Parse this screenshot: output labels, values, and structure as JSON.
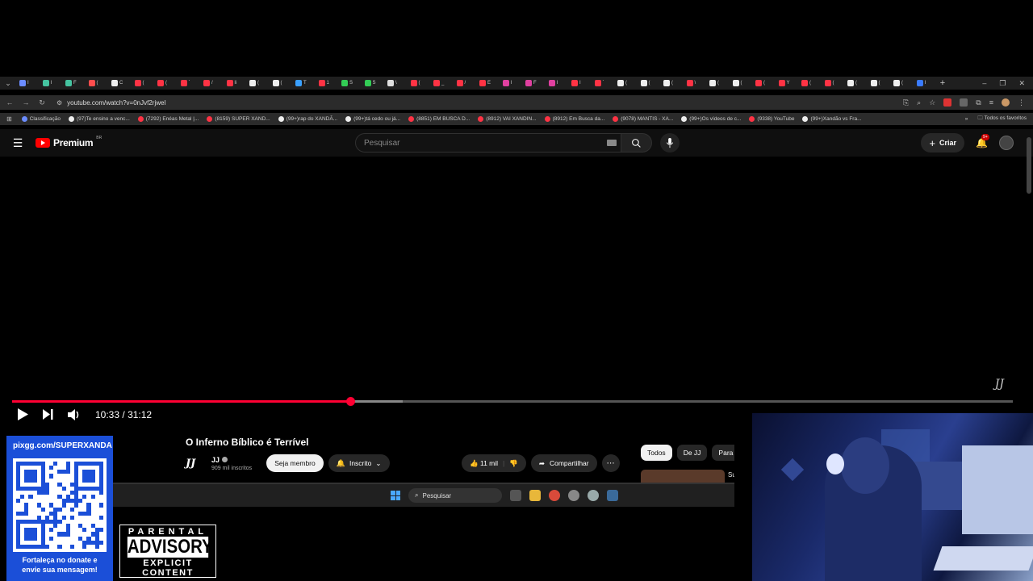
{
  "browser": {
    "tabs": [
      {
        "text": "I",
        "color": "#6b8cff"
      },
      {
        "text": "I",
        "color": "#45c3a0"
      },
      {
        "text": "F",
        "color": "#45c3a0"
      },
      {
        "text": "(",
        "color": "#ff4d4d"
      },
      {
        "text": "C",
        "color": "#eeeeee"
      },
      {
        "text": "(",
        "color": "#ff3344"
      },
      {
        "text": "(",
        "color": "#ff3344"
      },
      {
        "text": "`",
        "color": "#ff3344"
      },
      {
        "text": "/",
        "color": "#ff3344"
      },
      {
        "text": "li",
        "color": "#ff3344"
      },
      {
        "text": "(",
        "color": "#eeeeee"
      },
      {
        "text": "(",
        "color": "#eeeeee"
      },
      {
        "text": "T",
        "color": "#3aa0ff"
      },
      {
        "text": "1",
        "color": "#ff3344"
      },
      {
        "text": "S",
        "color": "#33cc55"
      },
      {
        "text": "S",
        "color": "#33cc55"
      },
      {
        "text": "\\",
        "color": "#dddddd"
      },
      {
        "text": "(",
        "color": "#ff3344"
      },
      {
        "text": "_",
        "color": "#ff3344"
      },
      {
        "text": "/",
        "color": "#ff3344"
      },
      {
        "text": "E",
        "color": "#ff3344"
      },
      {
        "text": "I",
        "color": "#e040a0"
      },
      {
        "text": "F",
        "color": "#e040a0"
      },
      {
        "text": "I",
        "color": "#e040a0"
      },
      {
        "text": "I",
        "color": "#ff3344"
      },
      {
        "text": "`",
        "color": "#ff3344"
      },
      {
        "text": "(",
        "color": "#eeeeee"
      },
      {
        "text": "(",
        "color": "#eeeeee"
      },
      {
        "text": "(",
        "color": "#eeeeee"
      },
      {
        "text": "\\",
        "color": "#ff3344"
      },
      {
        "text": "(",
        "color": "#eeeeee"
      },
      {
        "text": "(",
        "color": "#eeeeee"
      },
      {
        "text": "(",
        "color": "#ff3344"
      },
      {
        "text": "Y",
        "color": "#ff3344"
      },
      {
        "text": "(",
        "color": "#ff3344"
      },
      {
        "text": "(",
        "color": "#ff3344"
      },
      {
        "text": "(",
        "color": "#eeeeee"
      },
      {
        "text": "(",
        "color": "#eeeeee"
      },
      {
        "text": "(",
        "color": "#eeeeee"
      },
      {
        "text": "I",
        "color": "#3a7bff"
      }
    ],
    "new_tab": "+",
    "window_controls": [
      "–",
      "❐",
      "✕"
    ],
    "url": "youtube.com/watch?v=0nJvf2rjweI",
    "bookmarks": [
      {
        "label": "Classificação",
        "color": "#6b8cff"
      },
      {
        "label": "(97)Te ensino a venc...",
        "color": "#eeeeee"
      },
      {
        "label": "(7292) Enéas Metal |...",
        "color": "#ff3344"
      },
      {
        "label": "(8159) SUPER XAND...",
        "color": "#ff3344"
      },
      {
        "label": "(99+)rap do XANDÃ...",
        "color": "#eeeeee"
      },
      {
        "label": "(99+)tá cedo ou já...",
        "color": "#eeeeee"
      },
      {
        "label": "(8851) EM BUSCA D...",
        "color": "#ff3344"
      },
      {
        "label": "(8912) VAI XANDIN...",
        "color": "#ff3344"
      },
      {
        "label": "(8912) Em Busca da...",
        "color": "#ff3344"
      },
      {
        "label": "(9078) MANTIS - XA...",
        "color": "#ff3344"
      },
      {
        "label": "(99+)Os vídeos de c...",
        "color": "#eeeeee"
      },
      {
        "label": "(9338) YouTube",
        "color": "#ff3344"
      },
      {
        "label": "(99+)Xandão vs Fra...",
        "color": "#eeeeee"
      }
    ],
    "bookmarks_more": "»",
    "all_favorites": "Todos os favoritos"
  },
  "yt": {
    "logo_text": "Premium",
    "region": "BR",
    "search_placeholder": "Pesquisar",
    "create_label": "Criar",
    "notif_count": "9+"
  },
  "player": {
    "current_time": "10:33",
    "duration": "31:12",
    "time_sep": "/",
    "progress_played": 0.338,
    "progress_buffered": 0.39,
    "watermark": "JJ"
  },
  "video": {
    "title": "O Inferno Bíblico é Terrível",
    "channel_logo": "JJ",
    "channel_name": "JJ",
    "subscribers": "909 mil inscritos",
    "join_label": "Seja membro",
    "subscribed_label": "Inscrito",
    "likes": "11 mil",
    "share_label": "Compartilhar",
    "chips": [
      "Todos",
      "De JJ",
      "Para v"
    ],
    "side_text": "Su"
  },
  "taskbar": {
    "search_label": "Pesquisar"
  },
  "overlay": {
    "pix_url": "pixgg.com/SUPERXANDA",
    "pix_message_1": "Fortaleça no donate e",
    "pix_message_2": "envie sua mensagem!",
    "advisory_top": "PARENTAL",
    "advisory_mid": "ADVISORY",
    "advisory_bot": "EXPLICIT CONTENT"
  }
}
